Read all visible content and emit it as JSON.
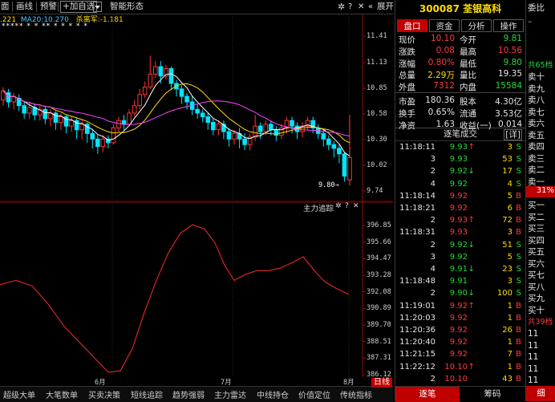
{
  "toolbar": {
    "items": [
      "面",
      "画线",
      "预警",
      "加自选",
      "智能形态"
    ],
    "expand_label": "展开"
  },
  "main_chart": {
    "info": {
      "ma1": ".221",
      "ma2": "MA20:10.270",
      "extra": "杀离军:-1.181"
    },
    "price_axis": [
      "11.41",
      "11.13",
      "10.85",
      "10.58",
      "10.30",
      "10.02",
      "9.74"
    ],
    "low_marker": "9.80",
    "date_labels": [
      "6月",
      "7月",
      "8月"
    ],
    "star_row": "***** *  *  ** *  *  *  *  *"
  },
  "indicator": {
    "title": "主力追踪",
    "axis": [
      "396.85",
      "395.66",
      "394.47",
      "393.28",
      "392.08",
      "390.89",
      "389.70",
      "388.51",
      "387.31",
      "386.12"
    ]
  },
  "bottom_tabs": [
    "超级大单",
    "大笔数单",
    "买卖决策",
    "短线追踪",
    "趋势强弱",
    "主力雷达",
    "中线持仓",
    "价值定位",
    "传统指标",
    "日线"
  ],
  "stock": {
    "code": "300087",
    "name": "荃银高科"
  },
  "panel_tabs": [
    "盘口",
    "资金",
    "分析",
    "操作"
  ],
  "quote": [
    {
      "l1": "现价",
      "v1": "10.10",
      "l2": "今开",
      "v2": "9.81",
      "c1": "red",
      "c2": "green"
    },
    {
      "l1": "涨跌",
      "v1": "0.08",
      "l2": "最高",
      "v2": "10.56",
      "c1": "red",
      "c2": "red"
    },
    {
      "l1": "涨幅",
      "v1": "0.80%",
      "l2": "最低",
      "v2": "9.80",
      "c1": "red",
      "c2": "green"
    },
    {
      "l1": "总量",
      "v1": "2.29万",
      "l2": "量比",
      "v2": "19.35",
      "c1": "yellow",
      "c2": "white"
    },
    {
      "l1": "外盘",
      "v1": "7312",
      "l2": "内盘",
      "v2": "15584",
      "c1": "red",
      "c2": "green"
    },
    {
      "l1": "市盈",
      "v1": "180.36",
      "l2": "股本",
      "v2": "4.30亿",
      "c1": "white",
      "c2": "white"
    },
    {
      "l1": "换手",
      "v1": "0.65%",
      "l2": "流通",
      "v2": "3.53亿",
      "c1": "white",
      "c2": "white"
    },
    {
      "l1": "净资",
      "v1": "1.63",
      "l2": "收益(一)",
      "v2": "0.014",
      "c1": "white",
      "c2": "white"
    }
  ],
  "trades_header": {
    "title": "逐笔成交",
    "detail": "[详]"
  },
  "trades": [
    {
      "time": "11:18:11",
      "price": "9.93",
      "dir": "up",
      "vol": "3",
      "side": "S"
    },
    {
      "time": "3",
      "price": "9.93",
      "dir": "",
      "vol": "53",
      "side": "S"
    },
    {
      "time": "2",
      "price": "9.92",
      "dir": "down",
      "vol": "17",
      "side": "S"
    },
    {
      "time": "4",
      "price": "9.92",
      "dir": "",
      "vol": "4",
      "side": "S"
    },
    {
      "time": "11:18:14",
      "price": "9.92",
      "dir": "",
      "vol": "5",
      "side": "B"
    },
    {
      "time": "11:18:21",
      "price": "9.92",
      "dir": "",
      "vol": "6",
      "side": "B"
    },
    {
      "time": "2",
      "price": "9.93",
      "dir": "up",
      "vol": "72",
      "side": "B"
    },
    {
      "time": "11:18:31",
      "price": "9.93",
      "dir": "",
      "vol": "3",
      "side": "B"
    },
    {
      "time": "2",
      "price": "9.92",
      "dir": "down",
      "vol": "51",
      "side": "S"
    },
    {
      "time": "3",
      "price": "9.92",
      "dir": "",
      "vol": "5",
      "side": "S"
    },
    {
      "time": "4",
      "price": "9.91",
      "dir": "down",
      "vol": "23",
      "side": "S"
    },
    {
      "time": "11:18:48",
      "price": "9.91",
      "dir": "",
      "vol": "3",
      "side": "S"
    },
    {
      "time": "2",
      "price": "9.90",
      "dir": "down",
      "vol": "100",
      "side": "S"
    },
    {
      "time": "11:19:01",
      "price": "9.92",
      "dir": "up",
      "vol": "1",
      "side": "B"
    },
    {
      "time": "11:20:03",
      "price": "9.92",
      "dir": "",
      "vol": "1",
      "side": "B"
    },
    {
      "time": "11:20:36",
      "price": "9.92",
      "dir": "",
      "vol": "26",
      "side": "B"
    },
    {
      "time": "11:20:40",
      "price": "9.92",
      "dir": "",
      "vol": "1",
      "side": "B"
    },
    {
      "time": "11:21:15",
      "price": "9.92",
      "dir": "",
      "vol": "7",
      "side": "B"
    },
    {
      "time": "11:22:12",
      "price": "10.10",
      "dir": "up",
      "vol": "1",
      "side": "B"
    },
    {
      "time": "2",
      "price": "10.10",
      "dir": "",
      "vol": "43",
      "side": "B"
    }
  ],
  "right_bottom_tabs": [
    "逐笔",
    "筹码"
  ],
  "order_book": {
    "top_label": "委比",
    "sells": [
      "卖十",
      "卖九",
      "卖八",
      "卖七",
      "卖六",
      "卖五",
      "卖四",
      "卖三",
      "卖二",
      "卖一"
    ],
    "sell_total": "共65档",
    "ratio": "31%",
    "buys": [
      "买一",
      "买二",
      "买三",
      "买四",
      "买五",
      "买六",
      "买七",
      "买八",
      "买九",
      "买十"
    ],
    "buy_total": "共39档",
    "bottom_labels": [
      "11",
      "11",
      "11",
      "11",
      "11"
    ],
    "bottom_tab": "细"
  }
}
